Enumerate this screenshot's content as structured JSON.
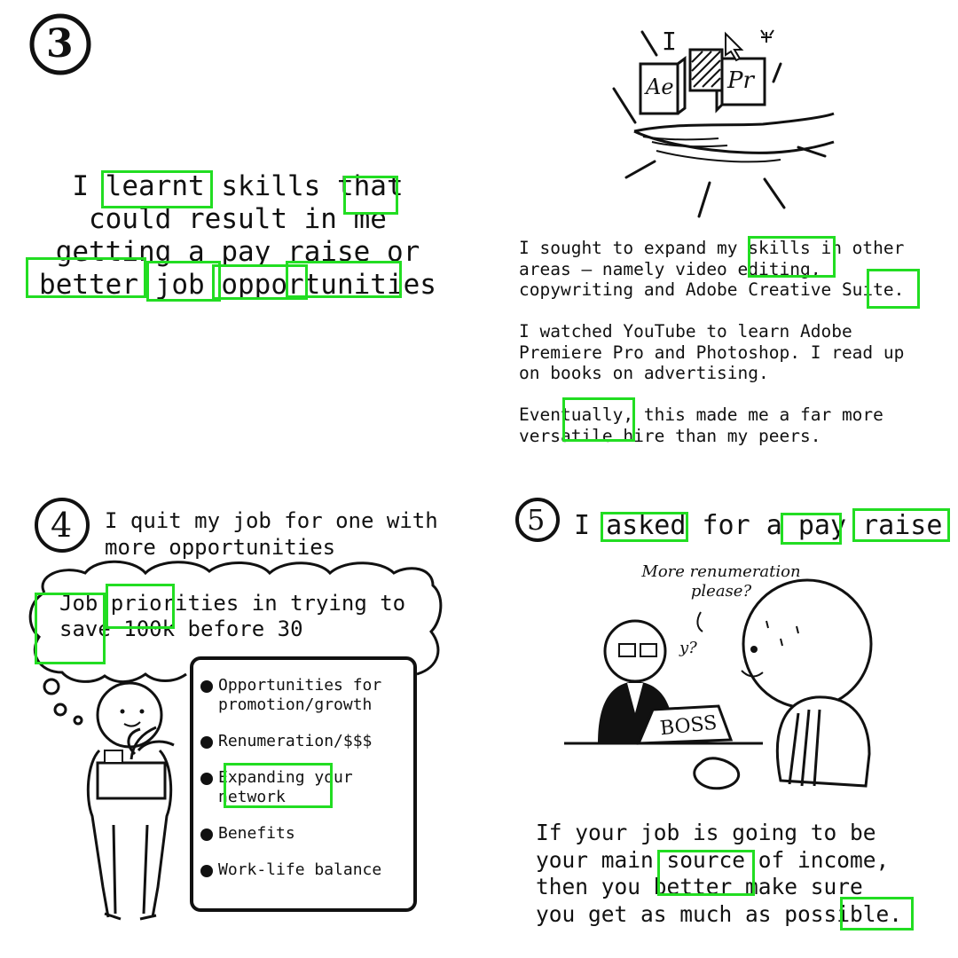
{
  "panels": {
    "p3": {
      "number": "3",
      "lines": [
        "I learnt skills that",
        "could result in me",
        "getting a pay raise or",
        "better job opportunities"
      ]
    },
    "p3b": {
      "para1": [
        "I sought to expand my skills in other",
        "areas – namely video editing,",
        "copywriting and Adobe Creative Suite."
      ],
      "para2": [
        "I watched YouTube to learn Adobe",
        "Premiere Pro and Photoshop. I read up",
        "on books on advertising."
      ],
      "para3": [
        "Eventually, this made me a far more",
        "versatile hire than my peers."
      ],
      "icons": {
        "ae": "Ae",
        "pr": "Pr",
        "cursor_letter": "I"
      }
    },
    "p4": {
      "number": "4",
      "title": [
        "I quit my job for one with",
        "more opportunities"
      ],
      "thought": [
        "Job priorities in trying to",
        "save 100k before 30"
      ],
      "list": [
        "Opportunities for\npromotion/growth",
        "Renumeration/$$$",
        "Expanding your\nnetwork",
        "Benefits",
        "Work-life balance"
      ]
    },
    "p5": {
      "number": "5",
      "title": "I asked for a pay raise",
      "speech": [
        "More renumeration",
        "please?"
      ],
      "boss_reply": "y?",
      "boss_sign": "BOSS",
      "caption": [
        "If your job is going to be",
        "your main source of income,",
        "then you better make sure",
        "you get as much as possible."
      ]
    }
  }
}
